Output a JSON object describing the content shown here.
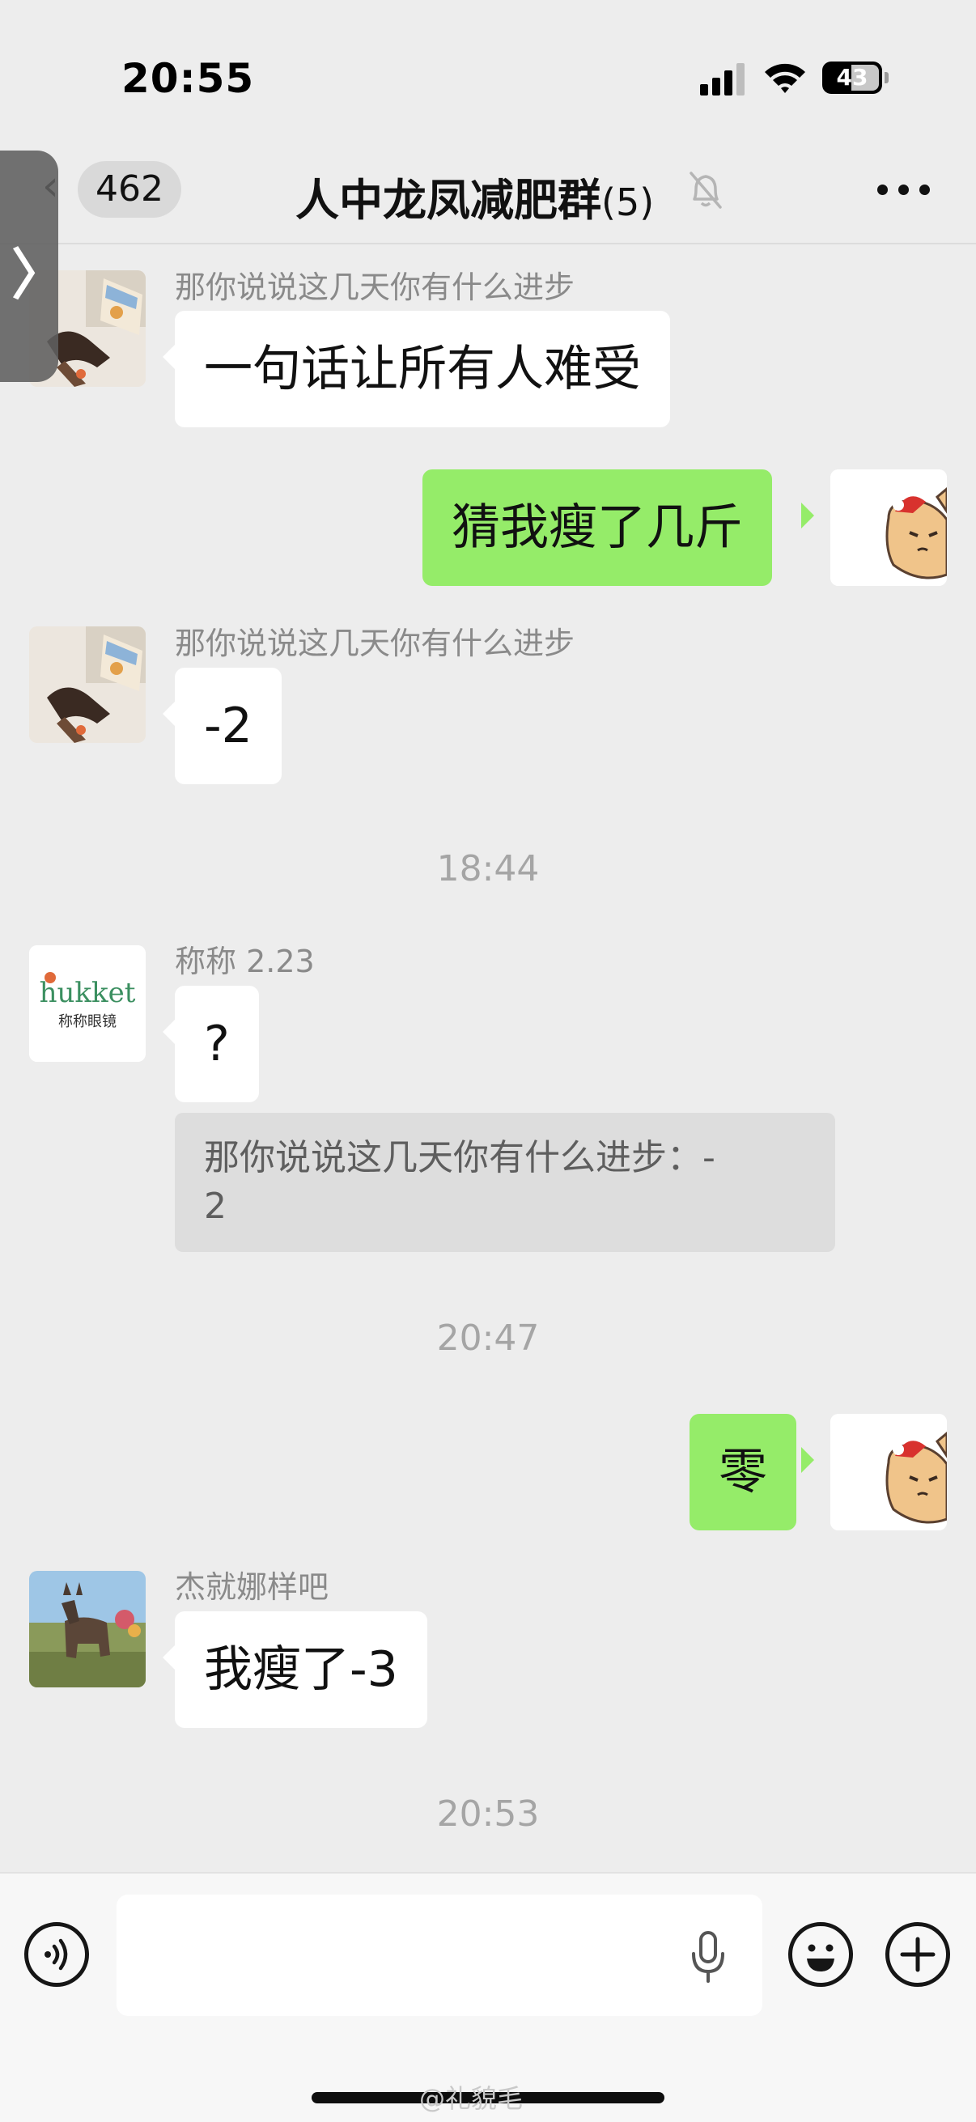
{
  "status_bar": {
    "time": "20:55",
    "battery": "43"
  },
  "header": {
    "unread_count": "462",
    "title": "人中龙凤减肥群",
    "member_count": "(5)",
    "icons": {
      "back": "chevron-left-icon",
      "mute": "bell-slash-icon",
      "more": "ellipsis-icon"
    }
  },
  "side_tab": {
    "glyph": "〉"
  },
  "messages": [
    {
      "sender": "那你说说这几天你有什么进步",
      "text": "一句话让所有人难受"
    },
    {
      "sender": "",
      "text": "猜我瘦了几斤"
    },
    {
      "sender": "那你说说这几天你有什么进步",
      "text": "-2"
    },
    {
      "sender": "称称 2.23",
      "text": "?"
    },
    {
      "sender": "",
      "text": "零"
    },
    {
      "sender": "杰就娜样吧",
      "text": "我瘦了-3"
    }
  ],
  "quote": {
    "text": "那你说说这几天你有什么进步：-\n2"
  },
  "timestamps": [
    "18:44",
    "20:47",
    "20:53"
  ],
  "avatars": {
    "hukket_line1": "hukket",
    "hukket_line2": "称称眼镜"
  },
  "input_bar": {
    "icons": [
      "voice-icon",
      "mic-icon",
      "emoji-icon",
      "plus-icon"
    ]
  },
  "watermark": "@礼貌毛",
  "colors": {
    "background": "#ededed",
    "outgoing_bubble": "#95ec69",
    "incoming_bubble": "#ffffff",
    "quote_bg": "#dddddd"
  }
}
